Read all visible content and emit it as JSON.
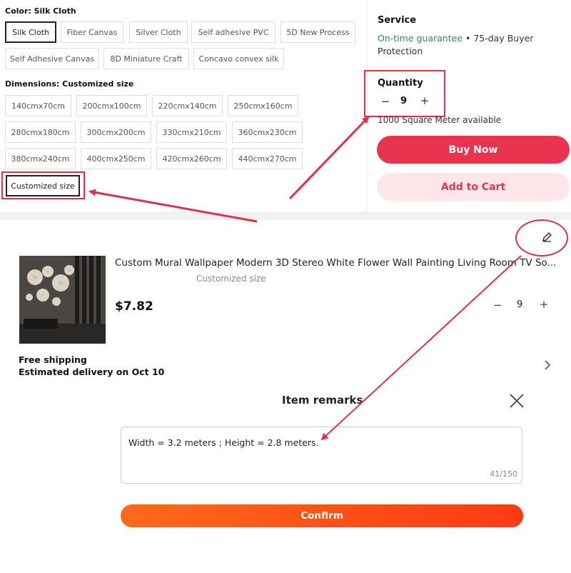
{
  "variants": {
    "color_label": "Color: Silk Cloth",
    "colors": [
      {
        "label": "Silk Cloth",
        "selected": true
      },
      {
        "label": "Fiber Canvas",
        "selected": false
      },
      {
        "label": "Silver Cloth",
        "selected": false
      },
      {
        "label": "Self adhesive PVC",
        "selected": false
      },
      {
        "label": "5D New Process",
        "selected": false
      },
      {
        "label": "Self Adhesive Canvas",
        "selected": false
      },
      {
        "label": "8D Miniature Craft",
        "selected": false
      },
      {
        "label": "Concavo convex silk",
        "selected": false
      }
    ],
    "dimensions_label": "Dimensions: Customized size",
    "sizes": [
      {
        "label": "140cmx70cm"
      },
      {
        "label": "200cmx100cm"
      },
      {
        "label": "220cmx140cm"
      },
      {
        "label": "250cmx160cm"
      },
      {
        "label": "280cmx180cm"
      },
      {
        "label": "300cmx200cm"
      },
      {
        "label": "330cmx210cm"
      },
      {
        "label": "360cmx230cm"
      },
      {
        "label": "380cmx240cm"
      },
      {
        "label": "400cmx250cm"
      },
      {
        "label": "420cmx260cm"
      },
      {
        "label": "440cmx270cm"
      },
      {
        "label": "Customized size",
        "selected": true
      }
    ]
  },
  "service": {
    "title": "Service",
    "guarantee": "On-time guarantee",
    "rest": " • 75-day Buyer Protection"
  },
  "quantity": {
    "title": "Quantity",
    "minus": "−",
    "value": "9",
    "plus": "+",
    "available": "1000 Square Meter available"
  },
  "actions": {
    "buy_now": "Buy Now",
    "add_to_cart": "Add to Cart"
  },
  "cart_item": {
    "title": "Custom Mural Wallpaper Modern 3D Stereo White Flower Wall Painting Living Room TV So...",
    "variant": "Customized size",
    "price": "$7.82",
    "minus": "−",
    "qty": "9",
    "plus": "+",
    "shipping": "Free shipping",
    "delivery": "Estimated delivery on Oct 10"
  },
  "remarks": {
    "title": "Item remarks",
    "text": "Width = 3.2 meters ; Height = 2.8 meters.",
    "counter": "41/150",
    "confirm": "Confirm"
  },
  "colors": {
    "accent": "#e8344e",
    "accent_light": "#fde6ea",
    "green": "#2e8b57",
    "annotation": "#e0304a",
    "confirm_start": "#ff6a1a",
    "confirm_end": "#ff3a14"
  },
  "icons": [
    "minus-icon",
    "plus-icon",
    "edit-pencil-icon",
    "chevron-right-icon",
    "close-icon"
  ]
}
